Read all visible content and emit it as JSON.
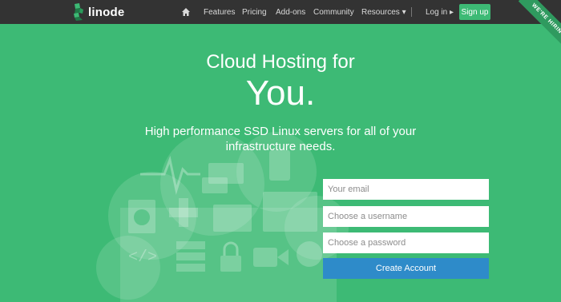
{
  "brand": {
    "name": "linode",
    "logo_icon": "linode-cube-logo"
  },
  "nav": {
    "home_icon": "home-icon",
    "items": [
      "Features",
      "Pricing",
      "Add-ons",
      "Community",
      "Resources ▾"
    ],
    "login": "Log in ▸",
    "signup": "Sign up"
  },
  "ribbon": "WE'RE HIRING!",
  "hero": {
    "line1": "Cloud Hosting for",
    "line2": "You.",
    "subtitle": "High performance SSD Linux servers for all of your infrastructure needs."
  },
  "cloud_icons": [
    "heartbeat-icon",
    "chat-bubbles-icon",
    "phone-icon",
    "shopping-bag-globe-icon",
    "medical-cross-icon",
    "envelope-icon",
    "browser-window-icon",
    "code-icon",
    "server-stack-icon",
    "padlock-icon",
    "video-camera-icon",
    "gear-icon"
  ],
  "signup_form": {
    "email_placeholder": "Your email",
    "username_placeholder": "Choose a username",
    "password_placeholder": "Choose a password",
    "submit": "Create Account"
  },
  "colors": {
    "brand_green": "#3dba75",
    "topbar": "#333333",
    "button_blue": "#2e8bc9",
    "ribbon": "#2f9a5f"
  }
}
